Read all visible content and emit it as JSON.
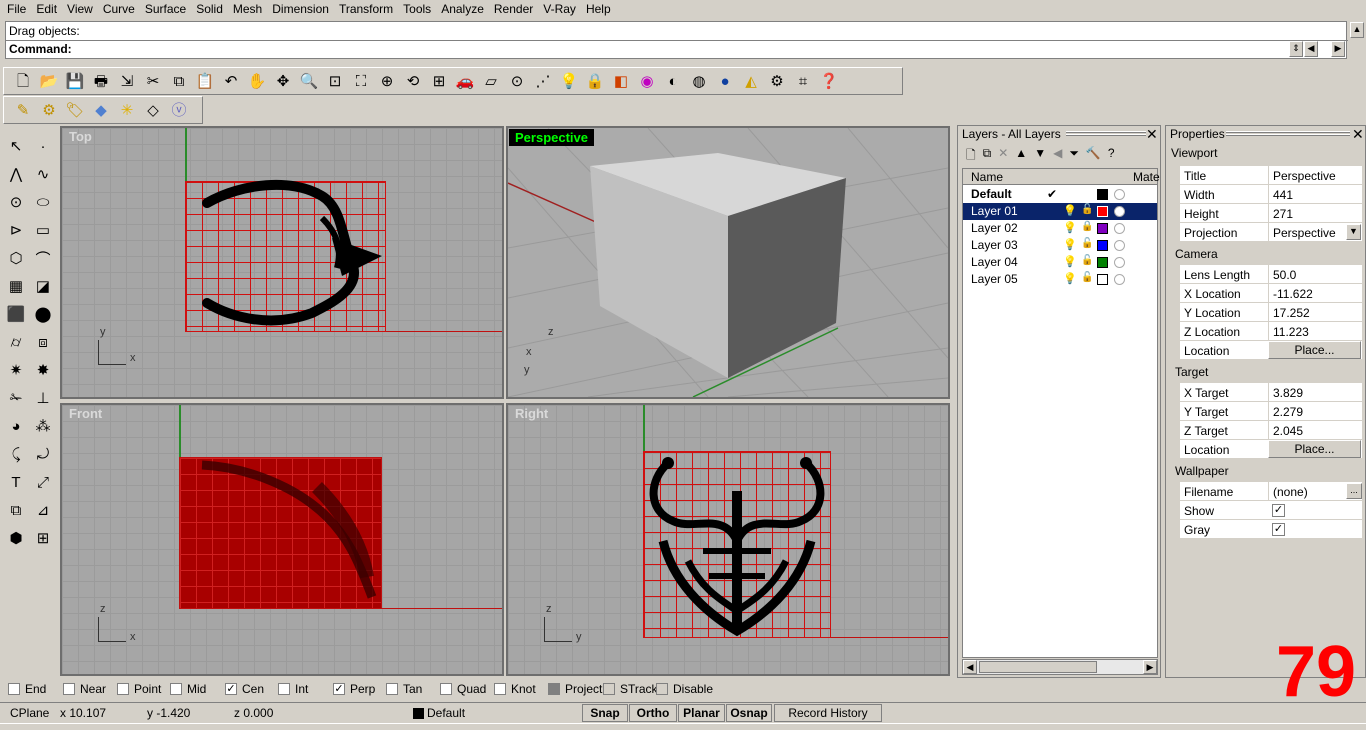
{
  "menu": [
    "File",
    "Edit",
    "View",
    "Curve",
    "Surface",
    "Solid",
    "Mesh",
    "Dimension",
    "Transform",
    "Tools",
    "Analyze",
    "Render",
    "V-Ray",
    "Help"
  ],
  "command": {
    "history": "Drag objects:",
    "label": "Command:",
    "value": ""
  },
  "viewports": {
    "top": {
      "title": "Top",
      "axes": [
        "y",
        "x"
      ]
    },
    "perspective": {
      "title": "Perspective",
      "axes": [
        "z",
        "x",
        "y"
      ]
    },
    "front": {
      "title": "Front",
      "axes": [
        "z",
        "x"
      ]
    },
    "right": {
      "title": "Right",
      "axes": [
        "z",
        "y"
      ]
    }
  },
  "layers": {
    "title": "Layers - All Layers",
    "columns": [
      "Name",
      "Mate"
    ],
    "rows": [
      {
        "name": "Default",
        "current": true,
        "color": "#000000"
      },
      {
        "name": "Layer 01",
        "selected": true,
        "color": "#ff0000"
      },
      {
        "name": "Layer 02",
        "color": "#8000c0",
        "locked": true
      },
      {
        "name": "Layer 03",
        "color": "#0000ff"
      },
      {
        "name": "Layer 04",
        "color": "#008000"
      },
      {
        "name": "Layer 05",
        "color": "#ffffff"
      }
    ],
    "current_mark": "✔"
  },
  "properties": {
    "title": "Properties",
    "section_viewport": "Viewport",
    "title_label": "Title",
    "title_value": "Perspective",
    "width_label": "Width",
    "width_value": "441",
    "height_label": "Height",
    "height_value": "271",
    "projection_label": "Projection",
    "projection_value": "Perspective",
    "section_camera": "Camera",
    "lens_label": "Lens Length",
    "lens_value": "50.0",
    "xloc_label": "X Location",
    "xloc_value": "-11.622",
    "yloc_label": "Y Location",
    "yloc_value": "17.252",
    "zloc_label": "Z Location",
    "zloc_value": "11.223",
    "location_label": "Location",
    "place_label": "Place...",
    "section_target": "Target",
    "xt_label": "X Target",
    "xt_value": "3.829",
    "yt_label": "Y Target",
    "yt_value": "2.279",
    "zt_label": "Z Target",
    "zt_value": "2.045",
    "section_wallpaper": "Wallpaper",
    "filename_label": "Filename",
    "filename_value": "(none)",
    "show_label": "Show",
    "gray_label": "Gray",
    "ellipsis": "..."
  },
  "osnap": {
    "items": [
      {
        "label": "End",
        "checked": false
      },
      {
        "label": "Near",
        "checked": false
      },
      {
        "label": "Point",
        "checked": false
      },
      {
        "label": "Mid",
        "checked": false
      },
      {
        "label": "Cen",
        "checked": true
      },
      {
        "label": "Int",
        "checked": false
      },
      {
        "label": "Perp",
        "checked": true
      },
      {
        "label": "Tan",
        "checked": false
      },
      {
        "label": "Quad",
        "checked": false
      },
      {
        "label": "Knot",
        "checked": false
      }
    ],
    "project": "Project",
    "strack": "STrack",
    "disable": "Disable"
  },
  "status": {
    "cplane": "CPlane",
    "x": "x 10.107",
    "y": "y -1.420",
    "z": "z 0.000",
    "layer": "Default",
    "snap": "Snap",
    "ortho": "Ortho",
    "planar": "Planar",
    "osnap": "Osnap",
    "record": "Record History"
  },
  "overlay_number": "79"
}
